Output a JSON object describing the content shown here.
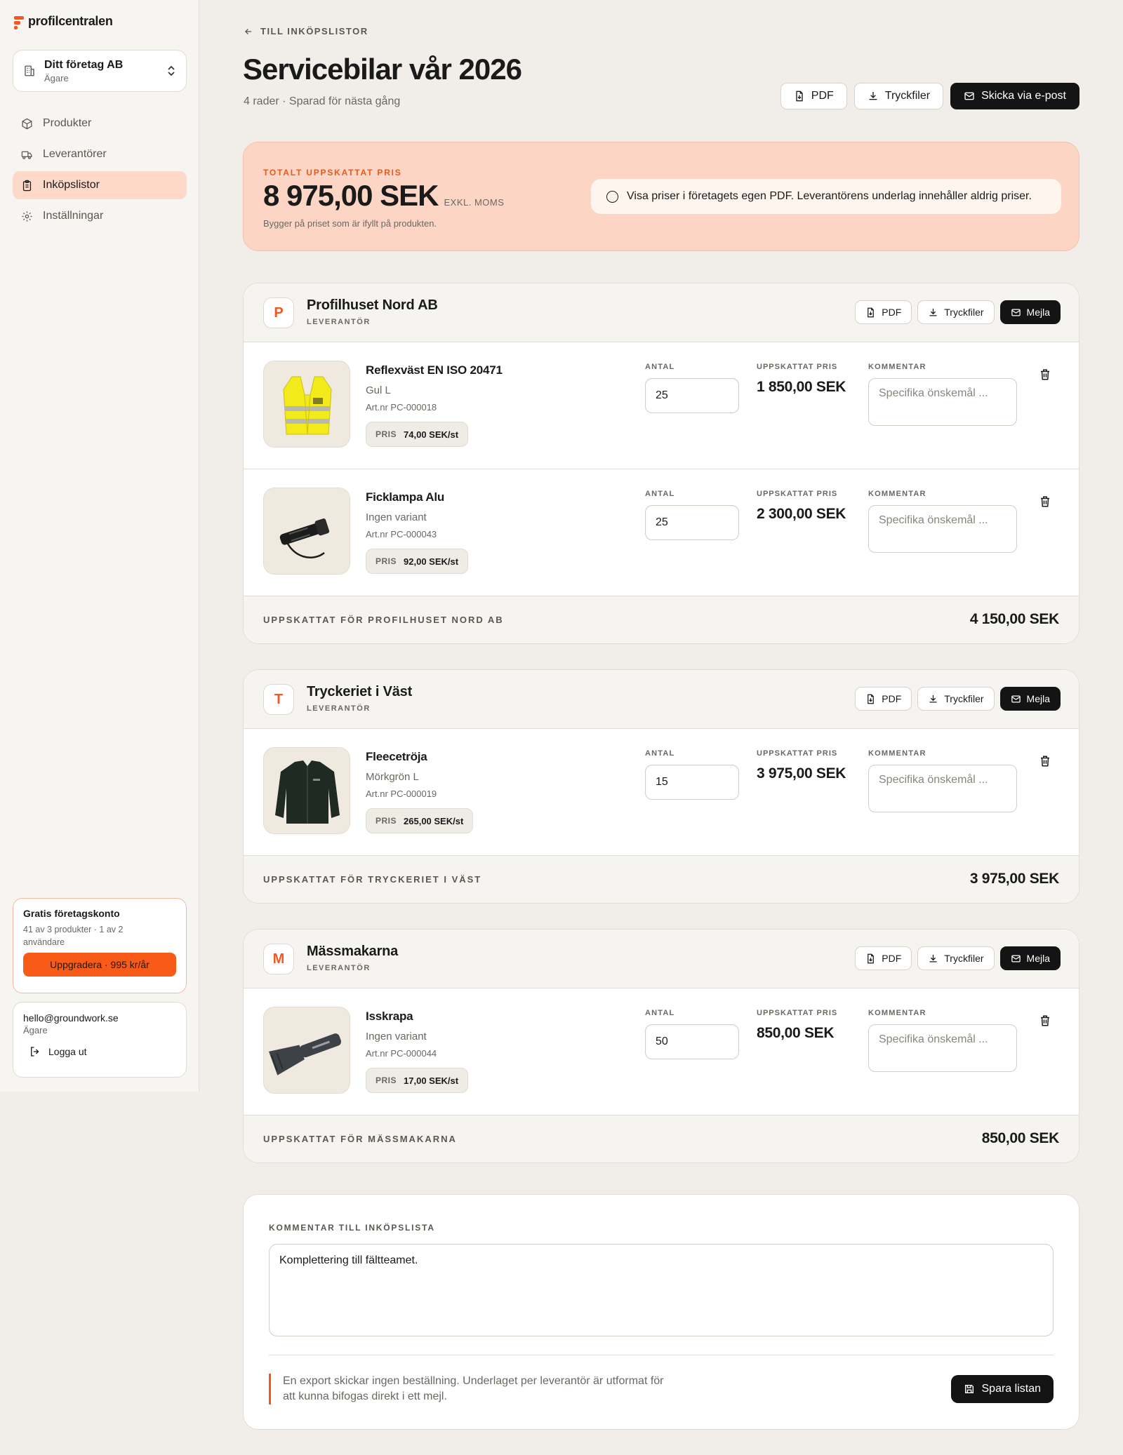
{
  "app": {
    "name": "profilcentralen"
  },
  "company": {
    "name": "Ditt företag AB",
    "role": "Ägare"
  },
  "nav": [
    {
      "label": "Produkter",
      "icon": "cube-icon",
      "active": false
    },
    {
      "label": "Leverantörer",
      "icon": "truck-icon",
      "active": false
    },
    {
      "label": "Inköpslistor",
      "icon": "clipboard-icon",
      "active": true
    },
    {
      "label": "Inställningar",
      "icon": "gear-icon",
      "active": false
    }
  ],
  "plan": {
    "title": "Gratis företagskonto",
    "desc": "41 av 3 produkter · 1 av 2 användare",
    "upgrade_label": "Uppgradera · 995 kr/år"
  },
  "user": {
    "email": "hello@groundwork.se",
    "role": "Ägare",
    "logout_label": "Logga ut"
  },
  "header": {
    "back_label": "TILL INKÖPSLISTOR",
    "title": "Servicebilar vår 2026",
    "subtitle": "4 rader · Sparad för nästa gång",
    "pdf_label": "PDF",
    "print_label": "Tryckfiler",
    "email_label": "Skicka via e-post"
  },
  "total": {
    "label": "TOTALT UPPSKATTAT PRIS",
    "amount": "8 975,00 SEK",
    "vat": "EXKL. MOMS",
    "note": "Bygger på priset som är ifyllt på produkten.",
    "toggle_label": "Visa priser i företagets egen PDF. Leverantörens underlag innehåller aldrig priser."
  },
  "labels": {
    "supplier_role": "LEVERANTÖR",
    "pdf": "PDF",
    "print": "Tryckfiler",
    "mail": "Mejla",
    "qty": "ANTAL",
    "est": "UPPSKATTAT PRIS",
    "comment": "KOMMENTAR",
    "comment_placeholder": "Specifika önskemål ...",
    "price": "PRIS"
  },
  "suppliers": [
    {
      "initial": "P",
      "name": "Profilhuset Nord AB",
      "items": [
        {
          "name": "Reflexväst EN ISO 20471",
          "variant": "Gul L",
          "art": "Art.nr PC-000018",
          "price": "74,00 SEK/st",
          "qty": "25",
          "est": "1 850,00 SEK",
          "image": "vest"
        },
        {
          "name": "Ficklampa Alu",
          "variant": "Ingen variant",
          "art": "Art.nr PC-000043",
          "price": "92,00 SEK/st",
          "qty": "25",
          "est": "2 300,00 SEK",
          "image": "flashlight"
        }
      ],
      "footer_label": "UPPSKATTAT FÖR PROFILHUSET NORD AB",
      "footer_value": "4 150,00 SEK"
    },
    {
      "initial": "T",
      "name": "Tryckeriet i Väst",
      "items": [
        {
          "name": "Fleecetröja",
          "variant": "Mörkgrön L",
          "art": "Art.nr PC-000019",
          "price": "265,00 SEK/st",
          "qty": "15",
          "est": "3 975,00 SEK",
          "image": "fleece"
        }
      ],
      "footer_label": "UPPSKATTAT FÖR TRYCKERIET I VÄST",
      "footer_value": "3 975,00 SEK"
    },
    {
      "initial": "M",
      "name": "Mässmakarna",
      "items": [
        {
          "name": "Isskrapa",
          "variant": "Ingen variant",
          "art": "Art.nr PC-000044",
          "price": "17,00 SEK/st",
          "qty": "50",
          "est": "850,00 SEK",
          "image": "scraper"
        }
      ],
      "footer_label": "UPPSKATTAT FÖR MÄSSMAKARNA",
      "footer_value": "850,00 SEK"
    }
  ],
  "list_comment": {
    "label": "KOMMENTAR TILL INKÖPSLISTA",
    "value": "Komplettering till fältteamet.",
    "note": "En export skickar ingen beställning. Underlaget per leverantör är utformat för att kunna bifogas direkt i ett mejl.",
    "save_label": "Spara listan"
  }
}
